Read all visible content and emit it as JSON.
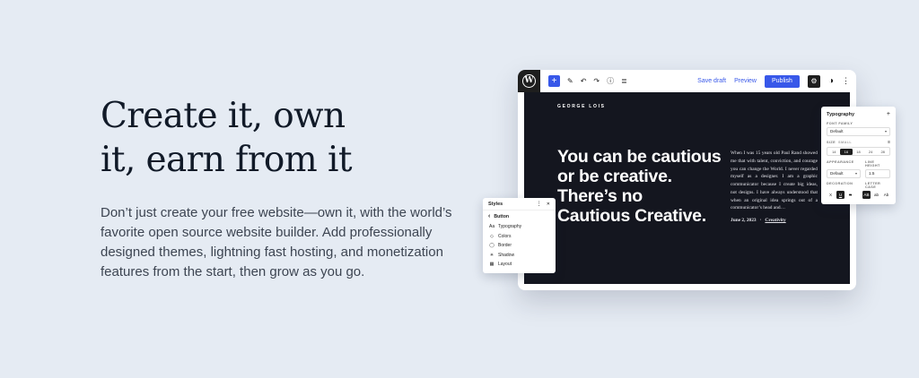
{
  "hero": {
    "heading_line1": "Create it, own",
    "heading_line2": "it, earn from it",
    "paragraph": "Don’t just create your free website—own it, with the world’s favorite open source website builder. Add professionally designed themes, lightning fast hosting, and monetization features from the start, then grow as you go."
  },
  "editor": {
    "toolbar": {
      "save_draft": "Save draft",
      "preview": "Preview",
      "publish": "Publish"
    },
    "canvas": {
      "site_title": "GEORGE LOIS",
      "quote_lines": [
        "You can be cautious",
        "or be creative.",
        "There’s no",
        "Cautious Creative."
      ],
      "excerpt": "When I was 15 years old Paul Rand showed me that with talent, conviction, and courage you can change the World. I never regarded myself as a designer. I am a graphic communicator because I create big ideas, not designs. I have always understood that when an original idea springs out of a communicator’s head and…",
      "date": "June 2, 2023",
      "separator": "·",
      "category": "Creativity"
    }
  },
  "styles_panel": {
    "title": "Styles",
    "back_label": "Button",
    "items": [
      {
        "icon": "Aa",
        "label": "Typography"
      },
      {
        "icon": "◇",
        "label": "Colors"
      },
      {
        "icon": "◯",
        "label": "Border"
      },
      {
        "icon": "✳",
        "label": "Shadow"
      },
      {
        "icon": "▦",
        "label": "Layout"
      }
    ]
  },
  "typography_panel": {
    "title": "Typography",
    "font_family_label": "FONT FAMILY",
    "font_family_value": "Default",
    "size_label": "SIZE",
    "size_current": "SMALL",
    "sizes": [
      "14",
      "16",
      "18",
      "24",
      "28"
    ],
    "selected_size": "16",
    "appearance_label": "APPEARANCE",
    "appearance_value": "Default",
    "line_height_label": "LINE HEIGHT",
    "line_height_value": "1.5",
    "decoration_label": "DECORATION",
    "decoration_options": [
      "X",
      "U",
      "S"
    ],
    "letter_case_label": "LETTER CASE",
    "letter_case_options": [
      "AB",
      "ab",
      "Ab"
    ]
  },
  "icons": {
    "wordpress": "W",
    "inserter_plus": "+",
    "tools_pencil": "✎",
    "undo": "↶",
    "redo": "↷",
    "info": "ⓘ",
    "list_view": "≣",
    "settings_gear": "⚙",
    "half_circle": "◑",
    "kebab": "⋮",
    "close": "✕",
    "chevron_left": "‹",
    "chevron_down": "▾",
    "plus": "+",
    "size_settings": "≡"
  },
  "colors": {
    "page_background": "#e5ebf3",
    "heading_text": "#111a28",
    "body_text": "#3d4552",
    "accent_blue": "#3858e9",
    "editor_canvas": "#14161f",
    "toolbar_dark": "#1e1e1e"
  }
}
